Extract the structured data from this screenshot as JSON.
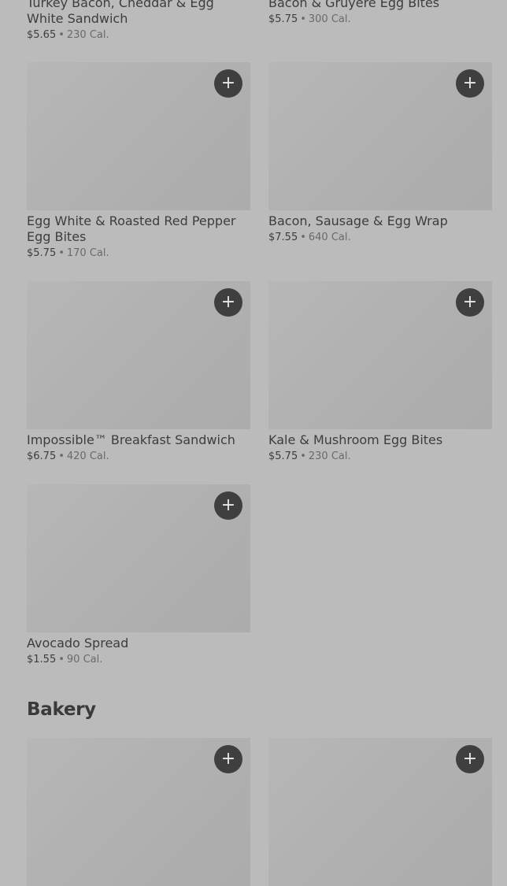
{
  "add_label": "+",
  "separator": "•",
  "top_items": [
    {
      "name": "Turkey Bacon, Cheddar & Egg White Sandwich",
      "price": "$5.65",
      "calories": "230 Cal."
    },
    {
      "name": "Bacon & Gruyère Egg Bites",
      "price": "$5.75",
      "calories": "300 Cal."
    }
  ],
  "items": [
    {
      "name": "Egg White & Roasted Red Pepper Egg Bites",
      "price": "$5.75",
      "calories": "170 Cal."
    },
    {
      "name": "Bacon, Sausage & Egg Wrap",
      "price": "$7.55",
      "calories": "640 Cal."
    },
    {
      "name": "Impossible™ Breakfast Sandwich",
      "price": "$6.75",
      "calories": "420 Cal."
    },
    {
      "name": "Kale & Mushroom Egg Bites",
      "price": "$5.75",
      "calories": "230 Cal."
    },
    {
      "name": "Avocado Spread",
      "price": "$1.55",
      "calories": "90 Cal."
    }
  ],
  "bakery": {
    "title": "Bakery"
  }
}
